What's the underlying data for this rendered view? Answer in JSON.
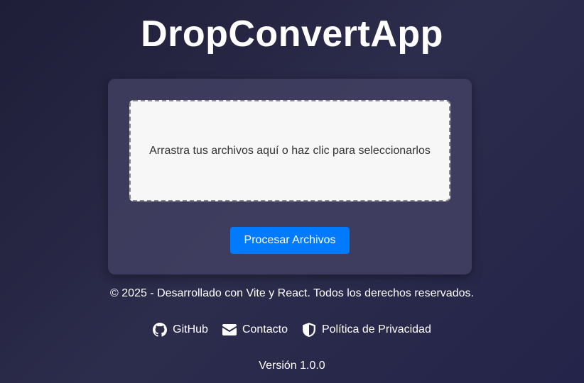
{
  "header": {
    "title": "DropConvertApp"
  },
  "uploader": {
    "dropzone_text": "Arrastra tus archivos aquí o haz clic para seleccionarlos",
    "process_button": "Procesar Archivos"
  },
  "footer": {
    "copyright": "© 2025 - Desarrollado con Vite y React. Todos los derechos reservados.",
    "links": [
      {
        "label": "GitHub",
        "icon": "github-icon"
      },
      {
        "label": "Contacto",
        "icon": "envelope-icon"
      },
      {
        "label": "Política de Privacidad",
        "icon": "shield-icon"
      }
    ],
    "version": "Versión 1.0.0"
  },
  "colors": {
    "accent": "#007bff",
    "background_start": "#1e1e38",
    "background_end": "#24244a",
    "card": "#464466",
    "dropzone": "#f7f7f7"
  }
}
